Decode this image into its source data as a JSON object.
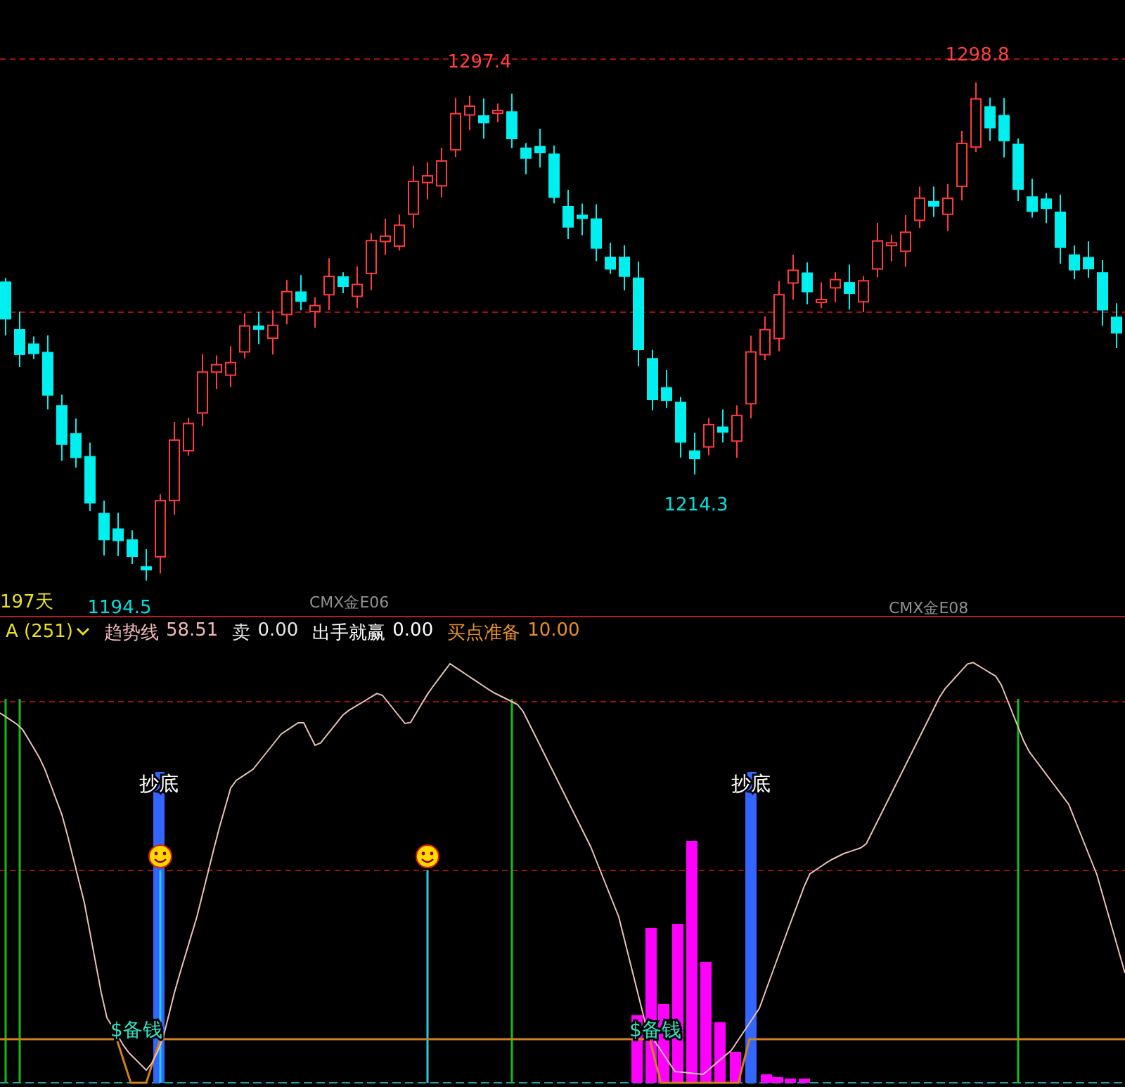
{
  "price_chart": {
    "extreme_labels": [
      {
        "text": "1297.4",
        "kind": "high"
      },
      {
        "text": "1298.8",
        "kind": "high"
      },
      {
        "text": "1214.3",
        "kind": "low"
      },
      {
        "text": "1194.5",
        "kind": "low"
      }
    ],
    "period_label": "197天",
    "contract_labels": [
      "CMX金E06",
      "CMX金E08"
    ]
  },
  "indicator": {
    "name": "A (251)",
    "legend": [
      {
        "name": "趋势线",
        "value": "58.51",
        "color": "#f0b8b8"
      },
      {
        "name": "卖",
        "value": "0.00",
        "color": "#e8e8e8"
      },
      {
        "name": "出手就赢",
        "value": "0.00",
        "color": "#ffffff"
      },
      {
        "name": "买点准备",
        "value": "10.00",
        "color": "#e8902a"
      }
    ],
    "signal_labels": [
      {
        "text": "抄底",
        "kind": "buy"
      },
      {
        "text": "抄底",
        "kind": "buy"
      },
      {
        "text": "$备钱",
        "kind": "ready"
      },
      {
        "text": "$备钱",
        "kind": "ready"
      }
    ]
  }
}
